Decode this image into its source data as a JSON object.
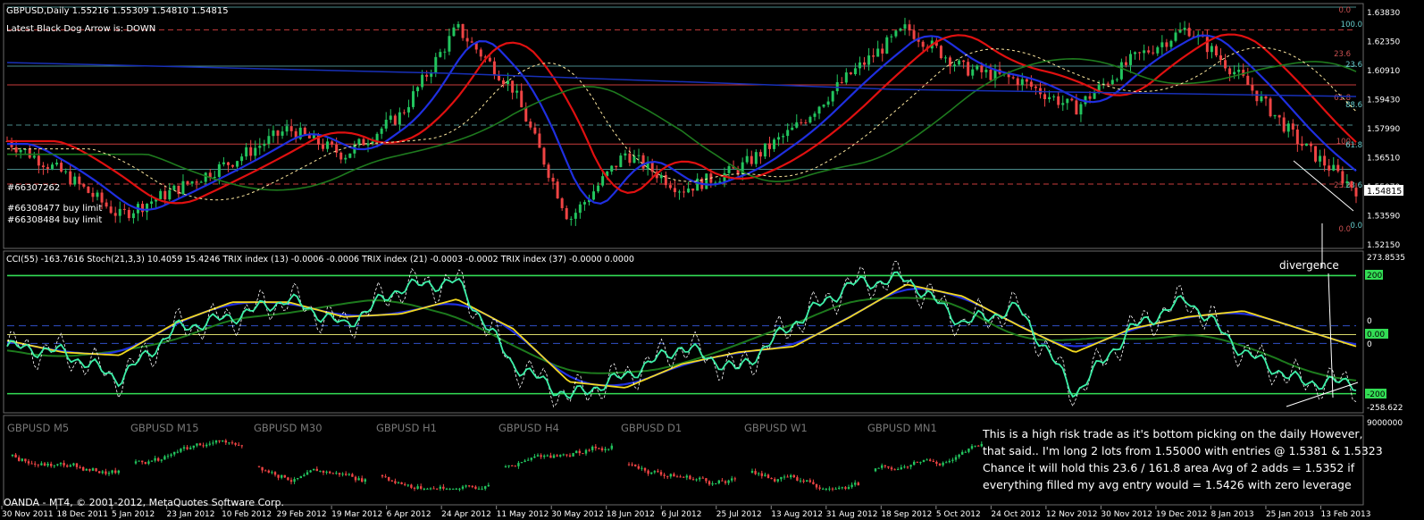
{
  "colors": {
    "background": "#000000",
    "bull_candle": "#22c55e",
    "bear_candle": "#ef4444",
    "ma_blue": "#1f2fe0",
    "ma_red": "#e01010",
    "ma_green": "#1e7a1e",
    "cci": "#3cf0a8",
    "trix_yellow": "#f2d81f",
    "level_line": "#c83c3c",
    "grid": "#4a8a8a",
    "cci_band": "#33dd55"
  },
  "header": {
    "symbol_line": "GBPUSD,Daily  1.55216 1.55309 1.54810 1.54815",
    "black_dog": "Latest Black Dog Arrow is:  DOWN"
  },
  "orders": [
    {
      "label": "#66307262"
    },
    {
      "label": "#66308477 buy limit"
    },
    {
      "label": "#66308484 buy limit"
    }
  ],
  "fib_labels_left": [
    "100.0",
    "23.6",
    "88.6",
    "61.8",
    "23.6",
    "0.0"
  ],
  "fib_labels_right": [
    "0.0",
    "23.6",
    "61.8",
    "100",
    "23.6",
    "0.0"
  ],
  "price_axis": [
    "1.63830",
    "1.62350",
    "1.60910",
    "1.59430",
    "1.57990",
    "1.56510",
    "1.55070",
    "1.53590",
    "1.52150"
  ],
  "current_price": "1.54815",
  "indicator_header": "CCI(55) -163.7616  Stoch(21,3,3) 10.4059 15.4246  TRIX index (13) -0.0006 -0.0006  TRIX index (21) -0.0003 -0.0002  TRIX index (37) -0.0000 0.0000",
  "indicator_axis": {
    "top": "273.8535",
    "plus200": "200",
    "zero_a": "0",
    "zero_b": "0.00",
    "zero_c": "0",
    "minus200": "-200",
    "bottom": "-258.622"
  },
  "divergence_label": "divergence",
  "mini_chart_axis": "9000000",
  "timeframes": [
    "GBPUSD M5",
    "GBPUSD M15",
    "GBPUSD M30",
    "GBPUSD H1",
    "GBPUSD H4",
    "GBPUSD D1",
    "GBPUSD W1",
    "GBPUSD MN1"
  ],
  "note_lines": [
    "This is a high risk trade as it's bottom picking on the daily However,",
    "that said.. I'm long 2 lots from 1.55000 with entries @ 1.5381 & 1.5323",
    "Chance it will hold this 23.6 / 161.8 area Avg of 2 adds = 1.5352 if",
    "everything filled my avg entry would = 1.5426 with zero leverage"
  ],
  "copyright": "OANDA - MT4, © 2001-2012, MetaQuotes Software Corp.",
  "chart_data": {
    "type": "candlestick",
    "title": "GBPUSD,Daily",
    "x_labels": [
      "30 Nov 2011",
      "18 Dec 2011",
      "5 Jan 2012",
      "23 Jan 2012",
      "10 Feb 2012",
      "29 Feb 2012",
      "19 Mar 2012",
      "6 Apr 2012",
      "24 Apr 2012",
      "11 May 2012",
      "30 May 2012",
      "18 Jun 2012",
      "6 Jul 2012",
      "25 Jul 2012",
      "13 Aug 2012",
      "31 Aug 2012",
      "18 Sep 2012",
      "5 Oct 2012",
      "24 Oct 2012",
      "12 Nov 2012",
      "30 Nov 2012",
      "19 Dec 2012",
      "8 Jan 2013",
      "25 Jan 2013",
      "13 Feb 2013"
    ],
    "ylim": [
      1.5215,
      1.6383
    ],
    "close_path": [
      [
        0,
        1.572
      ],
      [
        1,
        1.556
      ],
      [
        2,
        1.535
      ],
      [
        3,
        1.548
      ],
      [
        4,
        1.562
      ],
      [
        5,
        1.578
      ],
      [
        6,
        1.565
      ],
      [
        7,
        1.585
      ],
      [
        8,
        1.628
      ],
      [
        9,
        1.598
      ],
      [
        10,
        1.533
      ],
      [
        11,
        1.566
      ],
      [
        12,
        1.548
      ],
      [
        13,
        1.558
      ],
      [
        14,
        1.578
      ],
      [
        15,
        1.605
      ],
      [
        16,
        1.628
      ],
      [
        17,
        1.608
      ],
      [
        18,
        1.602
      ],
      [
        19,
        1.588
      ],
      [
        20,
        1.612
      ],
      [
        21,
        1.628
      ],
      [
        22,
        1.602
      ],
      [
        23,
        1.571
      ],
      [
        24,
        1.548
      ]
    ],
    "level_lines": [
      1.6383,
      1.6271,
      1.6091,
      1.5998,
      1.5799,
      1.5705,
      1.558,
      1.5507
    ],
    "indicator": {
      "name": "CCI(55)",
      "ylim": [
        -258.622,
        273.8535
      ],
      "bands": [
        200,
        0,
        -200
      ],
      "cci_path": [
        [
          0,
          -40
        ],
        [
          1,
          -60
        ],
        [
          2,
          -150
        ],
        [
          3,
          20
        ],
        [
          4,
          60
        ],
        [
          5,
          120
        ],
        [
          6,
          30
        ],
        [
          7,
          160
        ],
        [
          8,
          180
        ],
        [
          9,
          -100
        ],
        [
          10,
          -210
        ],
        [
          11,
          -140
        ],
        [
          12,
          -40
        ],
        [
          13,
          -120
        ],
        [
          14,
          40
        ],
        [
          15,
          170
        ],
        [
          16,
          190
        ],
        [
          17,
          40
        ],
        [
          18,
          90
        ],
        [
          19,
          -200
        ],
        [
          20,
          20
        ],
        [
          21,
          120
        ],
        [
          22,
          -60
        ],
        [
          23,
          -160
        ],
        [
          24,
          -164
        ]
      ],
      "trix_path": [
        [
          0,
          -20
        ],
        [
          1,
          -60
        ],
        [
          2,
          -70
        ],
        [
          3,
          40
        ],
        [
          4,
          110
        ],
        [
          5,
          110
        ],
        [
          6,
          60
        ],
        [
          7,
          70
        ],
        [
          8,
          120
        ],
        [
          9,
          20
        ],
        [
          10,
          -160
        ],
        [
          11,
          -180
        ],
        [
          12,
          -100
        ],
        [
          13,
          -60
        ],
        [
          14,
          -40
        ],
        [
          15,
          60
        ],
        [
          16,
          170
        ],
        [
          17,
          130
        ],
        [
          18,
          30
        ],
        [
          19,
          -60
        ],
        [
          20,
          20
        ],
        [
          21,
          60
        ],
        [
          22,
          80
        ],
        [
          23,
          20
        ],
        [
          24,
          -40
        ]
      ]
    }
  }
}
